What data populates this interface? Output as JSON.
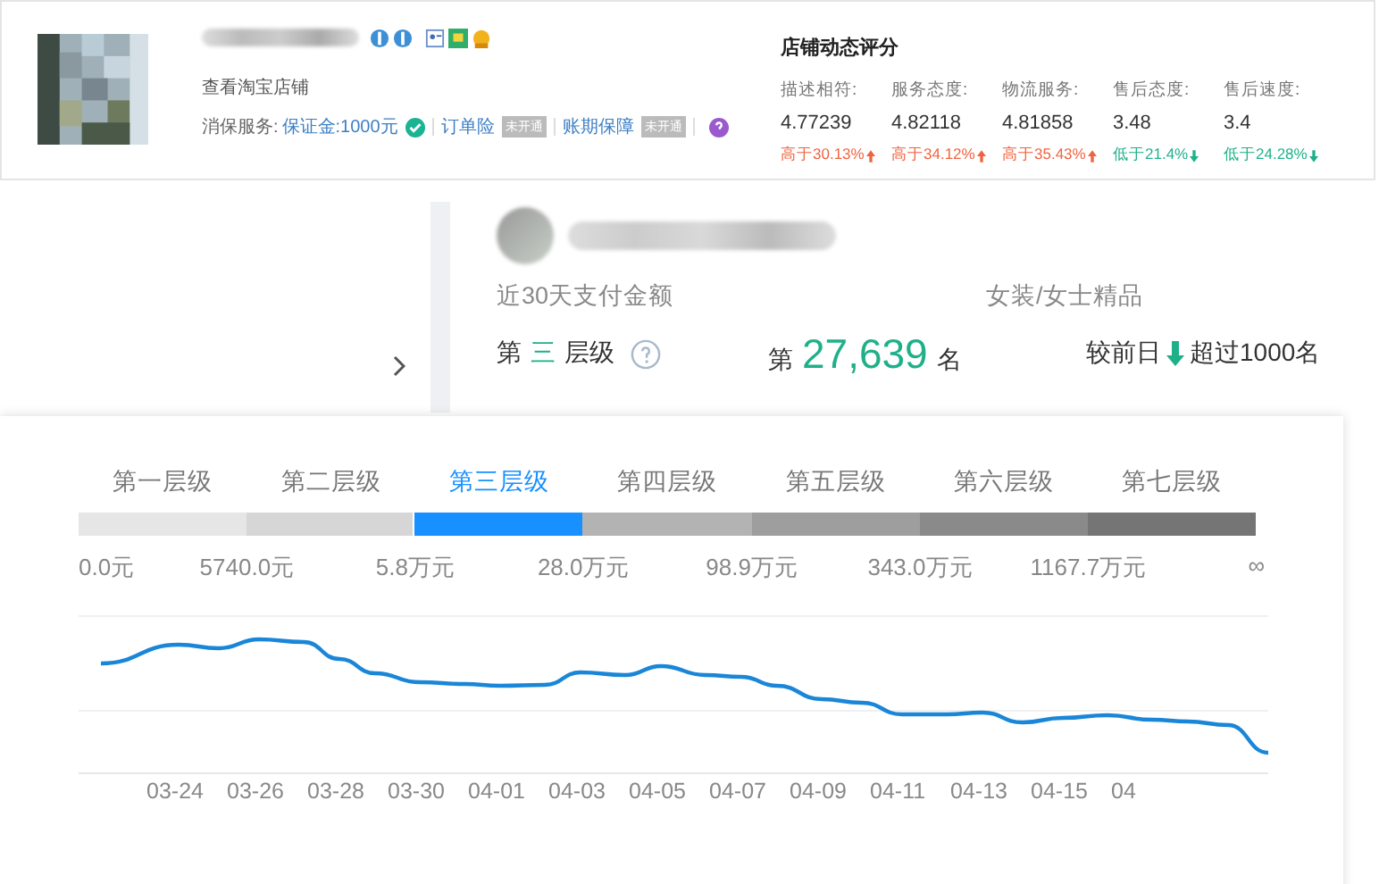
{
  "shop": {
    "link": "查看淘宝店铺",
    "service_label": "消保服务:",
    "deposit": "保证金:1000元",
    "services": [
      {
        "name": "订单险",
        "status": "未开通"
      },
      {
        "name": "账期保障",
        "status": "未开通"
      }
    ]
  },
  "rating": {
    "title": "店铺动态评分",
    "items": [
      {
        "label": "描述相符:",
        "value": "4.77239",
        "compare": "高于30.13%",
        "rising": true
      },
      {
        "label": "服务态度:",
        "value": "4.82118",
        "compare": "高于34.12%",
        "rising": true
      },
      {
        "label": "物流服务:",
        "value": "4.81858",
        "compare": "高于35.43%",
        "rising": true
      },
      {
        "label": "售后态度:",
        "value": "3.48",
        "compare": "低于21.4%",
        "rising": false
      },
      {
        "label": "售后速度:",
        "value": "3.4",
        "compare": "低于24.28%",
        "rising": false
      }
    ]
  },
  "rank": {
    "metric": "近30天支付金额",
    "category": "女装/女士精品",
    "tier_prefix": "第",
    "tier": "三",
    "tier_suffix": "层级",
    "rank_prefix": "第",
    "rank": "27,639",
    "rank_suffix": "名",
    "change_label": "较前日",
    "change_rising": false,
    "change": "超过1000名"
  },
  "tiers": [
    {
      "label": "第一层级",
      "selected": false,
      "color": "#e6e6e6"
    },
    {
      "label": "第二层级",
      "selected": false,
      "color": "#d6d6d6"
    },
    {
      "label": "第三层级",
      "selected": true,
      "color": "#1890ff"
    },
    {
      "label": "第四层级",
      "selected": false,
      "color": "#b3b3b3"
    },
    {
      "label": "第五层级",
      "selected": false,
      "color": "#9e9e9e"
    },
    {
      "label": "第六层级",
      "selected": false,
      "color": "#8a8a8a"
    },
    {
      "label": "第七层级",
      "selected": false,
      "color": "#757575"
    }
  ],
  "thresholds": [
    "0.0元",
    "5740.0元",
    "5.8万元",
    "28.0万元",
    "98.9万元",
    "343.0万元",
    "1167.7万元",
    "∞"
  ],
  "trend": {
    "dates": [
      "03-24",
      "03-26",
      "03-28",
      "03-30",
      "04-01",
      "04-03",
      "04-05",
      "04-07",
      "04-09",
      "04-11",
      "04-13",
      "04-15",
      "04"
    ]
  }
}
